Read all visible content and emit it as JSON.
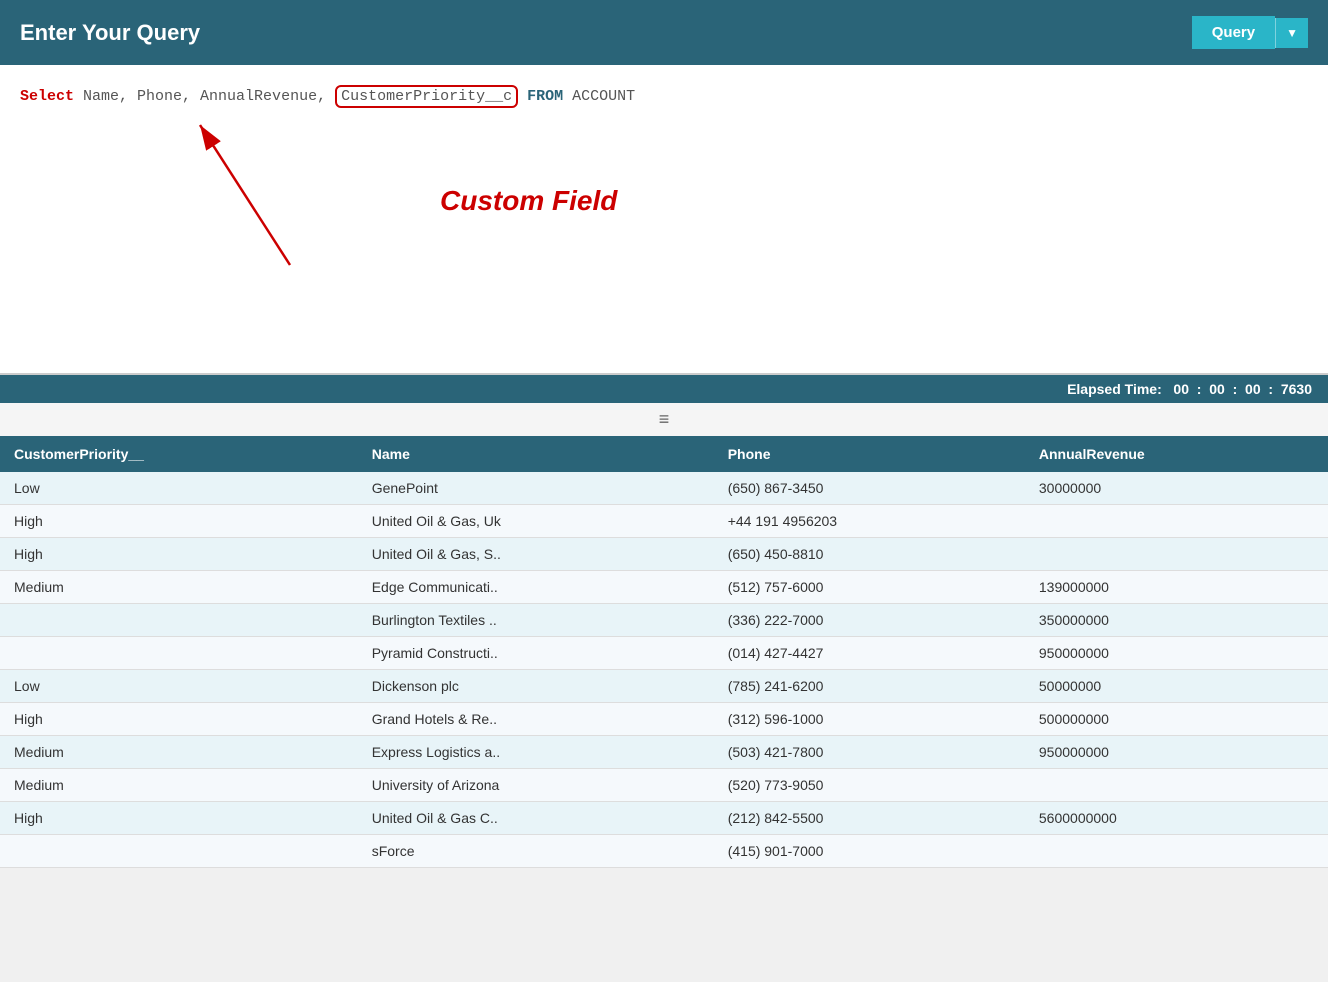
{
  "header": {
    "title": "Enter Your Query",
    "query_button_label": "Query",
    "dropdown_arrow": "▼"
  },
  "query_editor": {
    "keyword_select": "Select",
    "fields_plain": "Name, Phone, AnnualRevenue,",
    "custom_field": "CustomerPriority__c",
    "keyword_from": "FROM",
    "object_name": "ACCOUNT",
    "annotation_label": "Custom Field"
  },
  "elapsed_bar": {
    "label": "Elapsed Time:",
    "time_parts": [
      "00",
      "00",
      "00",
      "7630"
    ]
  },
  "drag_handle": "≡",
  "table": {
    "columns": [
      "CustomerPriority__",
      "Name",
      "Phone",
      "AnnualRevenue"
    ],
    "rows": [
      {
        "priority": "Low",
        "name": "GenePoint",
        "phone": "(650) 867-3450",
        "revenue": "30000000"
      },
      {
        "priority": "High",
        "name": "United Oil & Gas, Uk",
        "phone": "+44 191 4956203",
        "revenue": ""
      },
      {
        "priority": "High",
        "name": "United Oil & Gas, S..",
        "phone": "(650) 450-8810",
        "revenue": ""
      },
      {
        "priority": "Medium",
        "name": "Edge Communicati..",
        "phone": "(512) 757-6000",
        "revenue": "139000000"
      },
      {
        "priority": "",
        "name": "Burlington Textiles ..",
        "phone": "(336) 222-7000",
        "revenue": "350000000"
      },
      {
        "priority": "",
        "name": "Pyramid Constructi..",
        "phone": "(014) 427-4427",
        "revenue": "950000000"
      },
      {
        "priority": "Low",
        "name": "Dickenson plc",
        "phone": "(785) 241-6200",
        "revenue": "50000000"
      },
      {
        "priority": "High",
        "name": "Grand Hotels & Re..",
        "phone": "(312) 596-1000",
        "revenue": "500000000"
      },
      {
        "priority": "Medium",
        "name": "Express Logistics a..",
        "phone": "(503) 421-7800",
        "revenue": "950000000"
      },
      {
        "priority": "Medium",
        "name": "University of Arizona",
        "phone": "(520) 773-9050",
        "revenue": ""
      },
      {
        "priority": "High",
        "name": "United Oil & Gas C..",
        "phone": "(212) 842-5500",
        "revenue": "5600000000"
      },
      {
        "priority": "",
        "name": "sForce",
        "phone": "(415) 901-7000",
        "revenue": ""
      }
    ]
  }
}
